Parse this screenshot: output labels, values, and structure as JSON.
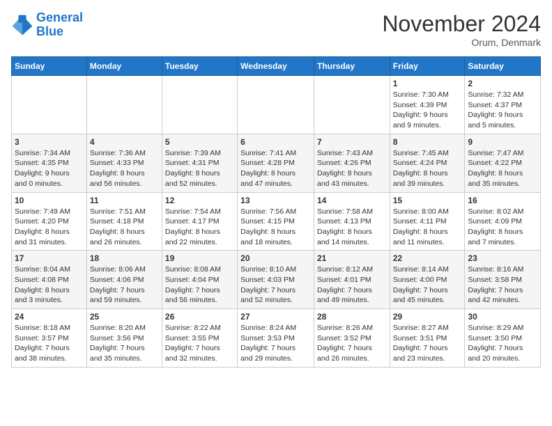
{
  "logo": {
    "line1": "General",
    "line2": "Blue"
  },
  "title": "November 2024",
  "location": "Orum, Denmark",
  "days_of_week": [
    "Sunday",
    "Monday",
    "Tuesday",
    "Wednesday",
    "Thursday",
    "Friday",
    "Saturday"
  ],
  "weeks": [
    [
      {
        "day": "",
        "sunrise": "",
        "sunset": "",
        "daylight": ""
      },
      {
        "day": "",
        "sunrise": "",
        "sunset": "",
        "daylight": ""
      },
      {
        "day": "",
        "sunrise": "",
        "sunset": "",
        "daylight": ""
      },
      {
        "day": "",
        "sunrise": "",
        "sunset": "",
        "daylight": ""
      },
      {
        "day": "",
        "sunrise": "",
        "sunset": "",
        "daylight": ""
      },
      {
        "day": "1",
        "sunrise": "Sunrise: 7:30 AM",
        "sunset": "Sunset: 4:39 PM",
        "daylight": "Daylight: 9 hours and 9 minutes."
      },
      {
        "day": "2",
        "sunrise": "Sunrise: 7:32 AM",
        "sunset": "Sunset: 4:37 PM",
        "daylight": "Daylight: 9 hours and 5 minutes."
      }
    ],
    [
      {
        "day": "3",
        "sunrise": "Sunrise: 7:34 AM",
        "sunset": "Sunset: 4:35 PM",
        "daylight": "Daylight: 9 hours and 0 minutes."
      },
      {
        "day": "4",
        "sunrise": "Sunrise: 7:36 AM",
        "sunset": "Sunset: 4:33 PM",
        "daylight": "Daylight: 8 hours and 56 minutes."
      },
      {
        "day": "5",
        "sunrise": "Sunrise: 7:39 AM",
        "sunset": "Sunset: 4:31 PM",
        "daylight": "Daylight: 8 hours and 52 minutes."
      },
      {
        "day": "6",
        "sunrise": "Sunrise: 7:41 AM",
        "sunset": "Sunset: 4:28 PM",
        "daylight": "Daylight: 8 hours and 47 minutes."
      },
      {
        "day": "7",
        "sunrise": "Sunrise: 7:43 AM",
        "sunset": "Sunset: 4:26 PM",
        "daylight": "Daylight: 8 hours and 43 minutes."
      },
      {
        "day": "8",
        "sunrise": "Sunrise: 7:45 AM",
        "sunset": "Sunset: 4:24 PM",
        "daylight": "Daylight: 8 hours and 39 minutes."
      },
      {
        "day": "9",
        "sunrise": "Sunrise: 7:47 AM",
        "sunset": "Sunset: 4:22 PM",
        "daylight": "Daylight: 8 hours and 35 minutes."
      }
    ],
    [
      {
        "day": "10",
        "sunrise": "Sunrise: 7:49 AM",
        "sunset": "Sunset: 4:20 PM",
        "daylight": "Daylight: 8 hours and 31 minutes."
      },
      {
        "day": "11",
        "sunrise": "Sunrise: 7:51 AM",
        "sunset": "Sunset: 4:18 PM",
        "daylight": "Daylight: 8 hours and 26 minutes."
      },
      {
        "day": "12",
        "sunrise": "Sunrise: 7:54 AM",
        "sunset": "Sunset: 4:17 PM",
        "daylight": "Daylight: 8 hours and 22 minutes."
      },
      {
        "day": "13",
        "sunrise": "Sunrise: 7:56 AM",
        "sunset": "Sunset: 4:15 PM",
        "daylight": "Daylight: 8 hours and 18 minutes."
      },
      {
        "day": "14",
        "sunrise": "Sunrise: 7:58 AM",
        "sunset": "Sunset: 4:13 PM",
        "daylight": "Daylight: 8 hours and 14 minutes."
      },
      {
        "day": "15",
        "sunrise": "Sunrise: 8:00 AM",
        "sunset": "Sunset: 4:11 PM",
        "daylight": "Daylight: 8 hours and 11 minutes."
      },
      {
        "day": "16",
        "sunrise": "Sunrise: 8:02 AM",
        "sunset": "Sunset: 4:09 PM",
        "daylight": "Daylight: 8 hours and 7 minutes."
      }
    ],
    [
      {
        "day": "17",
        "sunrise": "Sunrise: 8:04 AM",
        "sunset": "Sunset: 4:08 PM",
        "daylight": "Daylight: 8 hours and 3 minutes."
      },
      {
        "day": "18",
        "sunrise": "Sunrise: 8:06 AM",
        "sunset": "Sunset: 4:06 PM",
        "daylight": "Daylight: 7 hours and 59 minutes."
      },
      {
        "day": "19",
        "sunrise": "Sunrise: 8:08 AM",
        "sunset": "Sunset: 4:04 PM",
        "daylight": "Daylight: 7 hours and 56 minutes."
      },
      {
        "day": "20",
        "sunrise": "Sunrise: 8:10 AM",
        "sunset": "Sunset: 4:03 PM",
        "daylight": "Daylight: 7 hours and 52 minutes."
      },
      {
        "day": "21",
        "sunrise": "Sunrise: 8:12 AM",
        "sunset": "Sunset: 4:01 PM",
        "daylight": "Daylight: 7 hours and 49 minutes."
      },
      {
        "day": "22",
        "sunrise": "Sunrise: 8:14 AM",
        "sunset": "Sunset: 4:00 PM",
        "daylight": "Daylight: 7 hours and 45 minutes."
      },
      {
        "day": "23",
        "sunrise": "Sunrise: 8:16 AM",
        "sunset": "Sunset: 3:58 PM",
        "daylight": "Daylight: 7 hours and 42 minutes."
      }
    ],
    [
      {
        "day": "24",
        "sunrise": "Sunrise: 8:18 AM",
        "sunset": "Sunset: 3:57 PM",
        "daylight": "Daylight: 7 hours and 38 minutes."
      },
      {
        "day": "25",
        "sunrise": "Sunrise: 8:20 AM",
        "sunset": "Sunset: 3:56 PM",
        "daylight": "Daylight: 7 hours and 35 minutes."
      },
      {
        "day": "26",
        "sunrise": "Sunrise: 8:22 AM",
        "sunset": "Sunset: 3:55 PM",
        "daylight": "Daylight: 7 hours and 32 minutes."
      },
      {
        "day": "27",
        "sunrise": "Sunrise: 8:24 AM",
        "sunset": "Sunset: 3:53 PM",
        "daylight": "Daylight: 7 hours and 29 minutes."
      },
      {
        "day": "28",
        "sunrise": "Sunrise: 8:26 AM",
        "sunset": "Sunset: 3:52 PM",
        "daylight": "Daylight: 7 hours and 26 minutes."
      },
      {
        "day": "29",
        "sunrise": "Sunrise: 8:27 AM",
        "sunset": "Sunset: 3:51 PM",
        "daylight": "Daylight: 7 hours and 23 minutes."
      },
      {
        "day": "30",
        "sunrise": "Sunrise: 8:29 AM",
        "sunset": "Sunset: 3:50 PM",
        "daylight": "Daylight: 7 hours and 20 minutes."
      }
    ]
  ]
}
